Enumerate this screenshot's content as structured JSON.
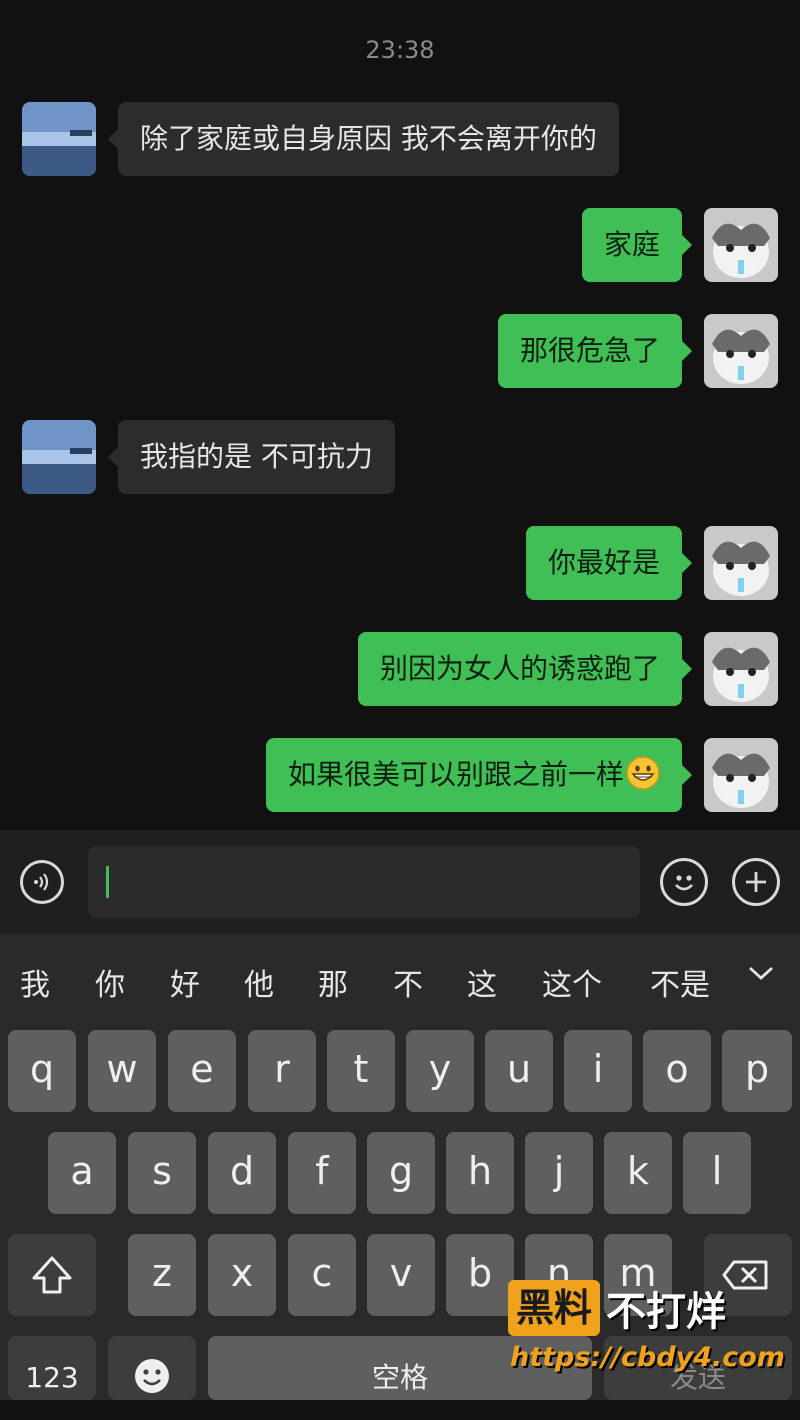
{
  "chat": {
    "timestamp": "23:38",
    "messages": [
      {
        "side": "in",
        "text": "除了家庭或自身原因 我不会离开你的"
      },
      {
        "side": "out",
        "text": "家庭"
      },
      {
        "side": "out",
        "text": "那很危急了"
      },
      {
        "side": "in",
        "text": "我指的是 不可抗力"
      },
      {
        "side": "out",
        "text": "你最好是"
      },
      {
        "side": "out",
        "text": "别因为女人的诱惑跑了"
      },
      {
        "side": "out",
        "text": "如果很美可以别跟之前一样",
        "emoji": "grinning-face-icon"
      }
    ]
  },
  "input_bar": {
    "voice_icon": "voice-icon",
    "emoji_icon": "smiley-icon",
    "plus_icon": "plus-icon",
    "value": "",
    "placeholder": ""
  },
  "keyboard": {
    "candidates": [
      "我",
      "你",
      "好",
      "他",
      "那",
      "不",
      "这",
      "这个",
      "不是"
    ],
    "rows": [
      [
        "q",
        "w",
        "e",
        "r",
        "t",
        "y",
        "u",
        "i",
        "o",
        "p"
      ],
      [
        "a",
        "s",
        "d",
        "f",
        "g",
        "h",
        "j",
        "k",
        "l"
      ],
      [
        "z",
        "x",
        "c",
        "v",
        "b",
        "n",
        "m"
      ]
    ],
    "shift_icon": "shift-icon",
    "backspace_icon": "backspace-icon",
    "num_label": "123",
    "emoji_key_icon": "emoji-key-icon",
    "space_label": "空格",
    "send_label": "发送"
  },
  "watermark": {
    "badge": "黑料",
    "text": "不打烊",
    "url": "https://cbdy4.com"
  },
  "colors": {
    "outgoing_bubble": "#3fbf55",
    "incoming_bubble": "#2c2c2c",
    "background": "#111111",
    "watermark_accent": "#f0a21c"
  }
}
